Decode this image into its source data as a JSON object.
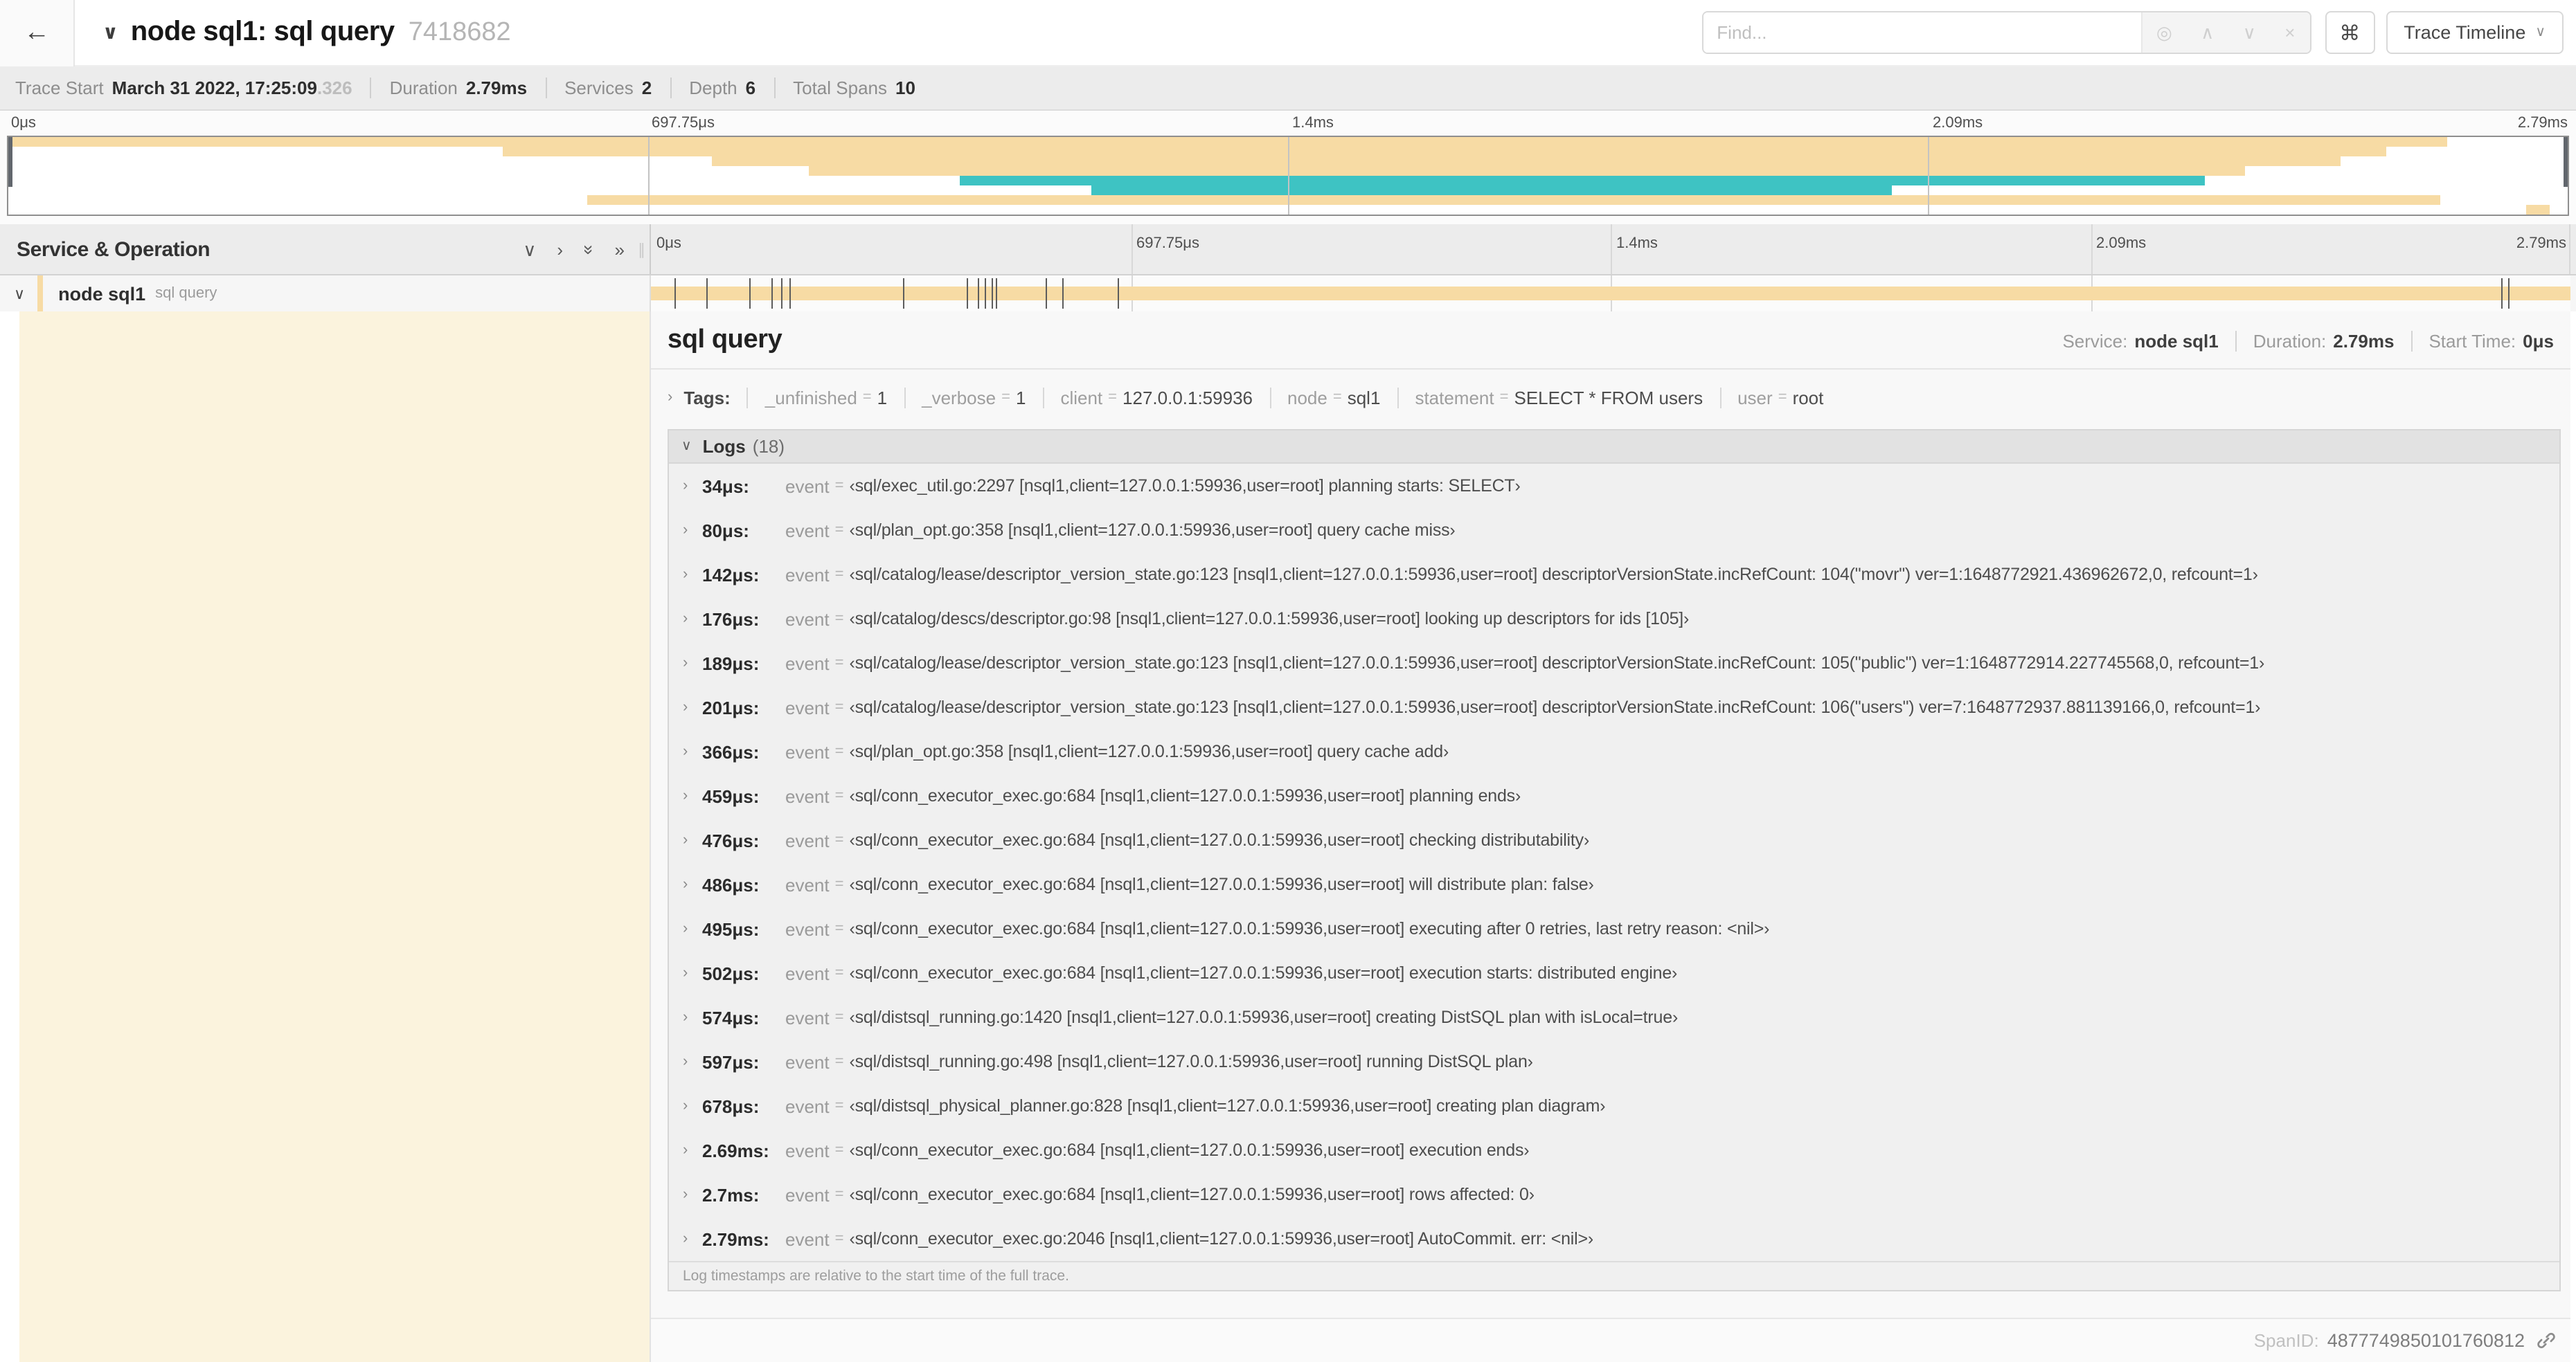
{
  "icons": {
    "back": "←",
    "chevron_down": "∨",
    "chevron_right": "›",
    "double_chevron": "»",
    "locate": "◎",
    "up": "∧",
    "down": "∨",
    "clear": "×",
    "command": "⌘",
    "caret": "∨"
  },
  "header": {
    "title": "node sql1: sql query",
    "trace_id": "7418682",
    "find_placeholder": "Find...",
    "view_selector": "Trace Timeline"
  },
  "summary": {
    "items": [
      {
        "label": "Trace Start",
        "value": "March 31 2022, 17:25:09",
        "suffix": ".326"
      },
      {
        "label": "Duration",
        "value": "2.79ms"
      },
      {
        "label": "Services",
        "value": "2"
      },
      {
        "label": "Depth",
        "value": "6"
      },
      {
        "label": "Total Spans",
        "value": "10"
      }
    ]
  },
  "ruler_ticks": [
    "0μs",
    "697.75μs",
    "1.4ms",
    "2.09ms",
    "2.79ms"
  ],
  "colors": {
    "tan": "#F7DBA4",
    "teal": "#3EC3C3"
  },
  "minimap": {
    "bars": [
      {
        "start": 0,
        "end": 95.3,
        "color": "tan"
      },
      {
        "start": 19.3,
        "end": 92.9,
        "color": "tan"
      },
      {
        "start": 27.5,
        "end": 91.1,
        "color": "tan"
      },
      {
        "start": 31.3,
        "end": 87.4,
        "color": "tan"
      },
      {
        "start": 37.2,
        "end": 85.8,
        "color": "teal"
      },
      {
        "start": 42.3,
        "end": 73.6,
        "color": "teal"
      },
      {
        "start": 22.6,
        "end": 95.0,
        "color": "tan"
      },
      {
        "start": 98.4,
        "end": 99.3,
        "color": "tan"
      }
    ]
  },
  "span_table": {
    "header": "Service & Operation",
    "row": {
      "service": "node sql1",
      "operation": "sql query"
    }
  },
  "timeline": {
    "total_us": 2790,
    "tick_times_us": [
      34,
      80,
      142,
      176,
      189,
      201,
      366,
      459,
      476,
      486,
      495,
      502,
      574,
      597,
      678,
      2690,
      2700,
      2790
    ]
  },
  "detail": {
    "title": "sql query",
    "meta": [
      {
        "k": "Service:",
        "v": "node sql1"
      },
      {
        "k": "Duration:",
        "v": "2.79ms"
      },
      {
        "k": "Start Time:",
        "v": "0μs"
      }
    ],
    "tags": {
      "label": "Tags:",
      "items": [
        {
          "key": "_unfinished",
          "value": "1"
        },
        {
          "key": "_verbose",
          "value": "1"
        },
        {
          "key": "client",
          "value": "127.0.0.1:59936"
        },
        {
          "key": "node",
          "value": "sql1"
        },
        {
          "key": "statement",
          "value": "SELECT * FROM users"
        },
        {
          "key": "user",
          "value": "root"
        }
      ]
    },
    "logs": {
      "label": "Logs",
      "count": "(18)",
      "key_label": "event",
      "entries": [
        {
          "time": "34μs:",
          "value": "‹sql/exec_util.go:2297 [nsql1,client=127.0.0.1:59936,user=root] planning starts: SELECT›"
        },
        {
          "time": "80μs:",
          "value": "‹sql/plan_opt.go:358 [nsql1,client=127.0.0.1:59936,user=root] query cache miss›"
        },
        {
          "time": "142μs:",
          "value": "‹sql/catalog/lease/descriptor_version_state.go:123 [nsql1,client=127.0.0.1:59936,user=root] descriptorVersionState.incRefCount: 104(\"movr\") ver=1:1648772921.436962672,0, refcount=1›"
        },
        {
          "time": "176μs:",
          "value": "‹sql/catalog/descs/descriptor.go:98 [nsql1,client=127.0.0.1:59936,user=root] looking up descriptors for ids [105]›"
        },
        {
          "time": "189μs:",
          "value": "‹sql/catalog/lease/descriptor_version_state.go:123 [nsql1,client=127.0.0.1:59936,user=root] descriptorVersionState.incRefCount: 105(\"public\") ver=1:1648772914.227745568,0, refcount=1›"
        },
        {
          "time": "201μs:",
          "value": "‹sql/catalog/lease/descriptor_version_state.go:123 [nsql1,client=127.0.0.1:59936,user=root] descriptorVersionState.incRefCount: 106(\"users\") ver=7:1648772937.881139166,0, refcount=1›"
        },
        {
          "time": "366μs:",
          "value": "‹sql/plan_opt.go:358 [nsql1,client=127.0.0.1:59936,user=root] query cache add›"
        },
        {
          "time": "459μs:",
          "value": "‹sql/conn_executor_exec.go:684 [nsql1,client=127.0.0.1:59936,user=root] planning ends›"
        },
        {
          "time": "476μs:",
          "value": "‹sql/conn_executor_exec.go:684 [nsql1,client=127.0.0.1:59936,user=root] checking distributability›"
        },
        {
          "time": "486μs:",
          "value": "‹sql/conn_executor_exec.go:684 [nsql1,client=127.0.0.1:59936,user=root] will distribute plan: false›"
        },
        {
          "time": "495μs:",
          "value": "‹sql/conn_executor_exec.go:684 [nsql1,client=127.0.0.1:59936,user=root] executing after 0 retries, last retry reason: <nil>›"
        },
        {
          "time": "502μs:",
          "value": "‹sql/conn_executor_exec.go:684 [nsql1,client=127.0.0.1:59936,user=root] execution starts: distributed engine›"
        },
        {
          "time": "574μs:",
          "value": "‹sql/distsql_running.go:1420 [nsql1,client=127.0.0.1:59936,user=root] creating DistSQL plan with isLocal=true›"
        },
        {
          "time": "597μs:",
          "value": "‹sql/distsql_running.go:498 [nsql1,client=127.0.0.1:59936,user=root] running DistSQL plan›"
        },
        {
          "time": "678μs:",
          "value": "‹sql/distsql_physical_planner.go:828 [nsql1,client=127.0.0.1:59936,user=root] creating plan diagram›"
        },
        {
          "time": "2.69ms:",
          "value": "‹sql/conn_executor_exec.go:684 [nsql1,client=127.0.0.1:59936,user=root] execution ends›"
        },
        {
          "time": "2.7ms:",
          "value": "‹sql/conn_executor_exec.go:684 [nsql1,client=127.0.0.1:59936,user=root] rows affected: 0›"
        },
        {
          "time": "2.79ms:",
          "value": "‹sql/conn_executor_exec.go:2046 [nsql1,client=127.0.0.1:59936,user=root] AutoCommit. err: <nil>›"
        }
      ],
      "footnote": "Log timestamps are relative to the start time of the full trace."
    },
    "span_id_label": "SpanID:",
    "span_id": "4877749850101760812"
  }
}
